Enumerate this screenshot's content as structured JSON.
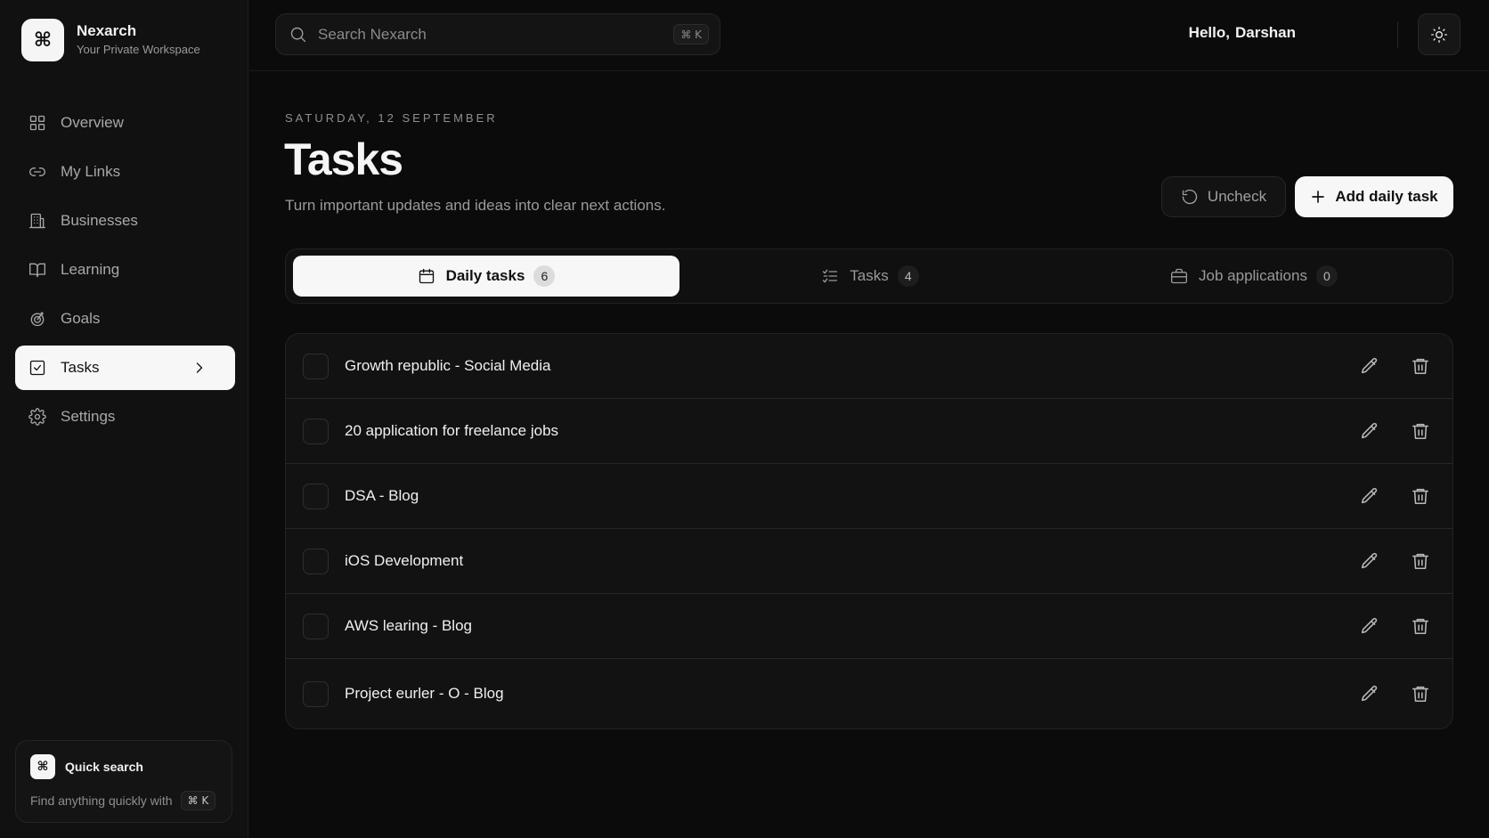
{
  "brand": {
    "logo_glyph": "⌘",
    "title": "Nexarch",
    "subtitle": "Your Private Workspace"
  },
  "sidebar": {
    "items": [
      {
        "label": "Overview",
        "icon": "grid-icon"
      },
      {
        "label": "My Links",
        "icon": "link-icon"
      },
      {
        "label": "Businesses",
        "icon": "building-icon"
      },
      {
        "label": "Learning",
        "icon": "book-icon"
      },
      {
        "label": "Goals",
        "icon": "target-icon"
      },
      {
        "label": "Tasks",
        "icon": "checkbox-icon",
        "active": true
      },
      {
        "label": "Settings",
        "icon": "gear-icon"
      }
    ],
    "quick_search": {
      "logo_glyph": "⌘",
      "title": "Quick search",
      "description": "Find anything quickly with",
      "shortcut": "⌘ K"
    }
  },
  "header": {
    "search_placeholder": "Search Nexarch",
    "search_shortcut": "⌘ K",
    "greeting": "Hello,",
    "user_name": "Darshan",
    "theme_toggle_icon": "sun-icon"
  },
  "main": {
    "date": "SATURDAY, 12 SEPTEMBER",
    "title": "Tasks",
    "description": "Turn important updates and ideas into clear next actions.",
    "uncheck_label": "Uncheck",
    "add_label": "Add daily task",
    "tabs": [
      {
        "label": "Daily tasks",
        "count": "6",
        "icon": "calendar-icon",
        "active": true
      },
      {
        "label": "Tasks",
        "count": "4",
        "icon": "list-check-icon"
      },
      {
        "label": "Job applications",
        "count": "0",
        "icon": "briefcase-icon"
      }
    ],
    "tasks": [
      {
        "label": "Growth republic - Social Media",
        "checked": false
      },
      {
        "label": "20 application for freelance jobs",
        "checked": false
      },
      {
        "label": "DSA - Blog",
        "checked": false
      },
      {
        "label": "iOS Development",
        "checked": false
      },
      {
        "label": "AWS learing - Blog",
        "checked": false
      },
      {
        "label": "Project eurler - O - Blog",
        "checked": false
      }
    ]
  },
  "colors": {
    "background": "#0b0b0b",
    "sidebar": "#111111",
    "active_bg": "#f7f7f7",
    "text_primary": "#f0f0f0",
    "text_muted": "#9a9a9a"
  }
}
